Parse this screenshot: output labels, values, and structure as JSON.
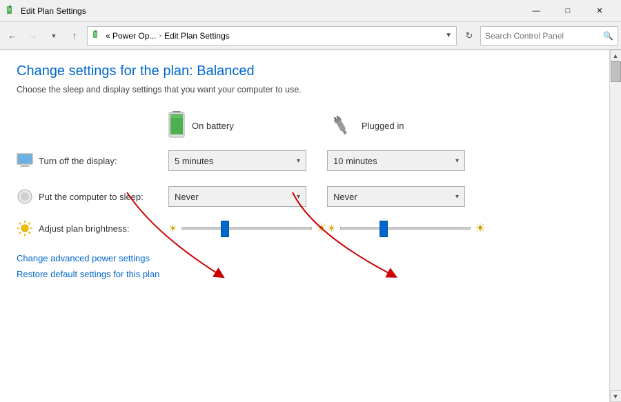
{
  "titlebar": {
    "title": "Edit Plan Settings",
    "icon_unicode": "⚡",
    "minimize": "—",
    "maximize": "□",
    "close": "✕"
  },
  "addressbar": {
    "back_tooltip": "Back",
    "forward_tooltip": "Forward",
    "up_tooltip": "Up",
    "breadcrumb_prefix": "«  Power Op...",
    "breadcrumb_sep": "›",
    "breadcrumb_current": "Edit Plan Settings",
    "refresh_unicode": "↻",
    "search_placeholder": "Search Control Panel",
    "search_icon": "🔍"
  },
  "page": {
    "title": "Change settings for the plan: Balanced",
    "subtitle": "Choose the sleep and display settings that you want your computer to use.",
    "on_battery_label": "On battery",
    "plugged_in_label": "Plugged in",
    "display_label": "Turn off the display:",
    "sleep_label": "Put the computer to sleep:",
    "brightness_label": "Adjust plan brightness:",
    "display_battery_value": "5 minutes",
    "display_plugged_value": "10 minutes",
    "sleep_battery_value": "Never",
    "sleep_plugged_value": "Never",
    "link_advanced": "Change advanced power settings",
    "link_restore": "Restore default settings for this plan",
    "dropdown_arrow": "▾"
  }
}
